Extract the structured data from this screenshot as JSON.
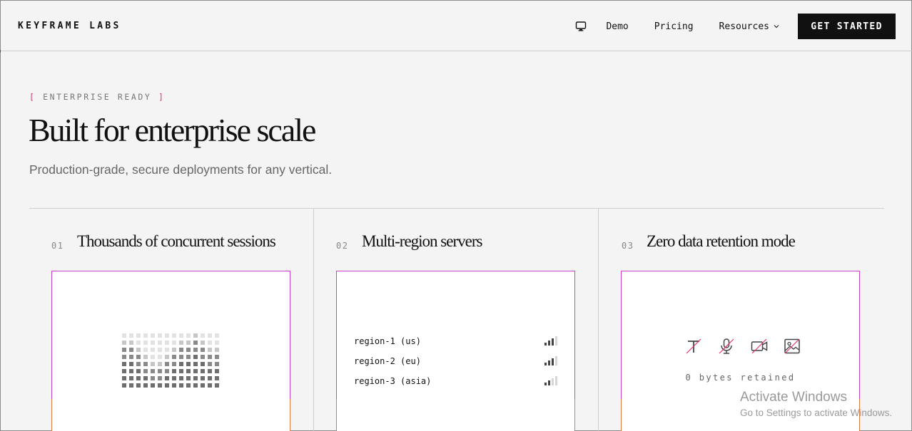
{
  "nav": {
    "brand": "KEYFRAME LABS",
    "icon": "monitor-icon",
    "links": [
      "Demo",
      "Pricing",
      "Resources"
    ],
    "cta": "GET STARTED"
  },
  "hero": {
    "eyebrow_open": "[",
    "eyebrow": "ENTERPRISE READY",
    "eyebrow_close": "]",
    "title": "Built for enterprise scale",
    "subtitle": "Production-grade, secure deployments for any vertical."
  },
  "cards": [
    {
      "num": "01",
      "title": "Thousands of concurrent sessions"
    },
    {
      "num": "02",
      "title": "Multi-region servers",
      "regions": [
        {
          "label": "region-1 (us)",
          "signal": 3
        },
        {
          "label": "region-2 (eu)",
          "signal": 3
        },
        {
          "label": "region-3 (asia)",
          "signal": 2
        }
      ]
    },
    {
      "num": "03",
      "title": "Zero data retention mode",
      "icons": [
        "text-off-icon",
        "microphone-off-icon",
        "video-off-icon",
        "image-off-icon"
      ],
      "caption": "0 bytes retained"
    }
  ],
  "watermark": {
    "line1": "Activate Windows",
    "line2": "Go to Settings to activate Windows."
  },
  "colors": {
    "accent": "#e0336f",
    "panel_border": "#c93fcf",
    "cta_bg": "#111111"
  }
}
